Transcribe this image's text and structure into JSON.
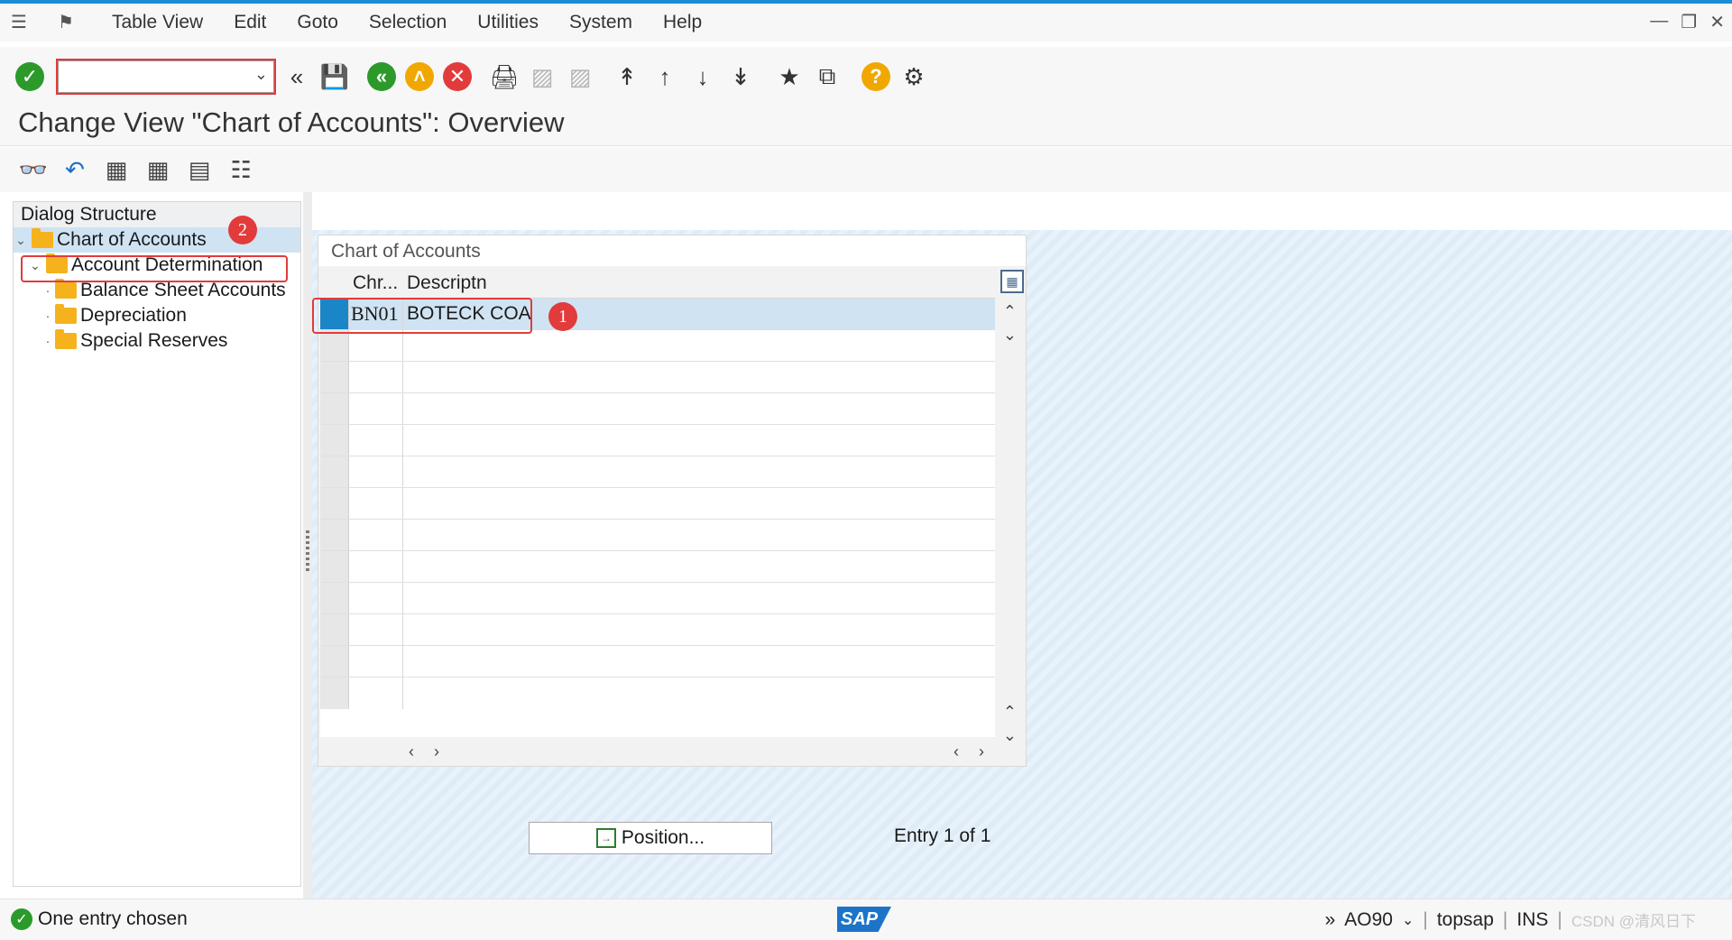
{
  "menubar": {
    "items": [
      "Table View",
      "Edit",
      "Goto",
      "Selection",
      "Utilities",
      "System",
      "Help"
    ]
  },
  "toolbar": {
    "command_field_value": "",
    "icons": [
      "enter-icon",
      "back-double-arrow-icon",
      "save-icon",
      "back-icon",
      "exit-icon",
      "cancel-icon",
      "print-icon",
      "find-icon",
      "find-next-icon",
      "first-page-icon",
      "previous-page-icon",
      "next-page-icon",
      "last-page-icon",
      "create-session-icon",
      "shortcut-icon",
      "help-icon",
      "settings-icon"
    ]
  },
  "page": {
    "title": "Change View \"Chart of Accounts\": Overview"
  },
  "dialog_structure": {
    "header": "Dialog Structure",
    "items": [
      {
        "label": "Chart of Accounts",
        "level": 0,
        "expanded": true,
        "selected": true
      },
      {
        "label": "Account Determination",
        "level": 1,
        "expanded": true,
        "selected": false
      },
      {
        "label": "Balance Sheet Accounts",
        "level": 2,
        "selected": false
      },
      {
        "label": "Depreciation",
        "level": 2,
        "selected": false
      },
      {
        "label": "Special Reserves",
        "level": 2,
        "selected": false
      }
    ],
    "marker": "2"
  },
  "table": {
    "caption": "Chart of Accounts",
    "columns": [
      "Chr...",
      "Descriptn"
    ],
    "rows": [
      {
        "chart": "BN01",
        "description": "BOTECK COA",
        "selected": true
      }
    ],
    "empty_rows": 13,
    "marker": "1"
  },
  "position_button": {
    "label": "Position..."
  },
  "entry_info": "Entry 1 of 1",
  "status": {
    "message": "One entry chosen",
    "transaction": "AO90",
    "server": "topsap",
    "mode": "INS",
    "watermark": "CSDN @清风日下"
  },
  "colors": {
    "accent": "#1b8dd6",
    "selection": "#cfe3f3",
    "marker_red": "#e23b3b"
  }
}
